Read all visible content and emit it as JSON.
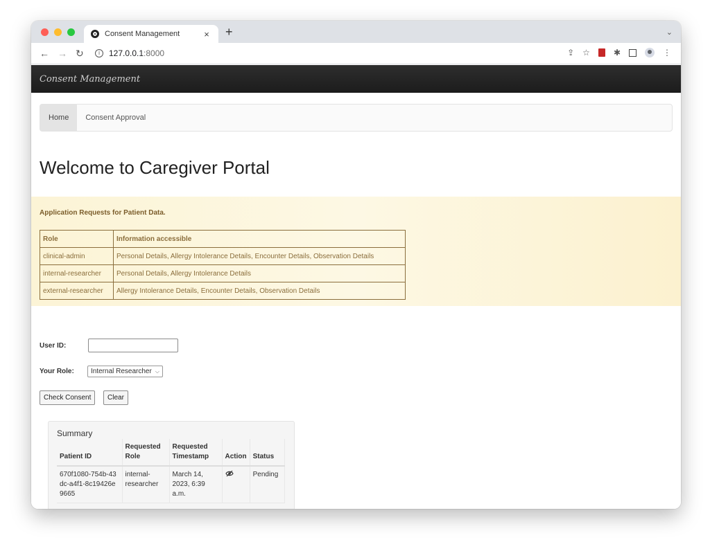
{
  "browser": {
    "tab_title": "Consent Management",
    "new_tab_symbol": "+",
    "url_host": "127.0.0.1",
    "url_port": ":8000",
    "traffic_light_colors": [
      "#fe5f57",
      "#febc2e",
      "#28c840"
    ]
  },
  "app": {
    "brand": "Consent Management",
    "nav": [
      {
        "label": "Home",
        "active": true
      },
      {
        "label": "Consent Approval",
        "active": false
      }
    ],
    "welcome": "Welcome to Caregiver Portal"
  },
  "requests": {
    "title": "Application Requests for Patient Data.",
    "headers": [
      "Role",
      "Information accessible"
    ],
    "rows": [
      [
        "clinical-admin",
        "Personal Details, Allergy Intolerance Details, Encounter Details, Observation Details"
      ],
      [
        "internal-researcher",
        "Personal Details, Allergy Intolerance Details"
      ],
      [
        "external-researcher",
        "Allergy Intolerance Details, Encounter Details, Observation Details"
      ]
    ]
  },
  "form": {
    "user_id_label": "User ID:",
    "user_id_value": "",
    "role_label": "Your Role:",
    "role_selected": "Internal Researcher",
    "check_button": "Check Consent",
    "clear_button": "Clear"
  },
  "summary": {
    "title": "Summary",
    "headers": [
      "Patient ID",
      "Requested Role",
      "Requested Timestamp",
      "Action",
      "Status"
    ],
    "rows": [
      {
        "patient_id": "670f1080-754b-43dc-a4f1-8c19426e9665",
        "role": "internal-researcher",
        "timestamp": "March 14, 2023, 6:39 a.m.",
        "action_icon": "hide-eye-icon",
        "status": "Pending"
      }
    ]
  }
}
